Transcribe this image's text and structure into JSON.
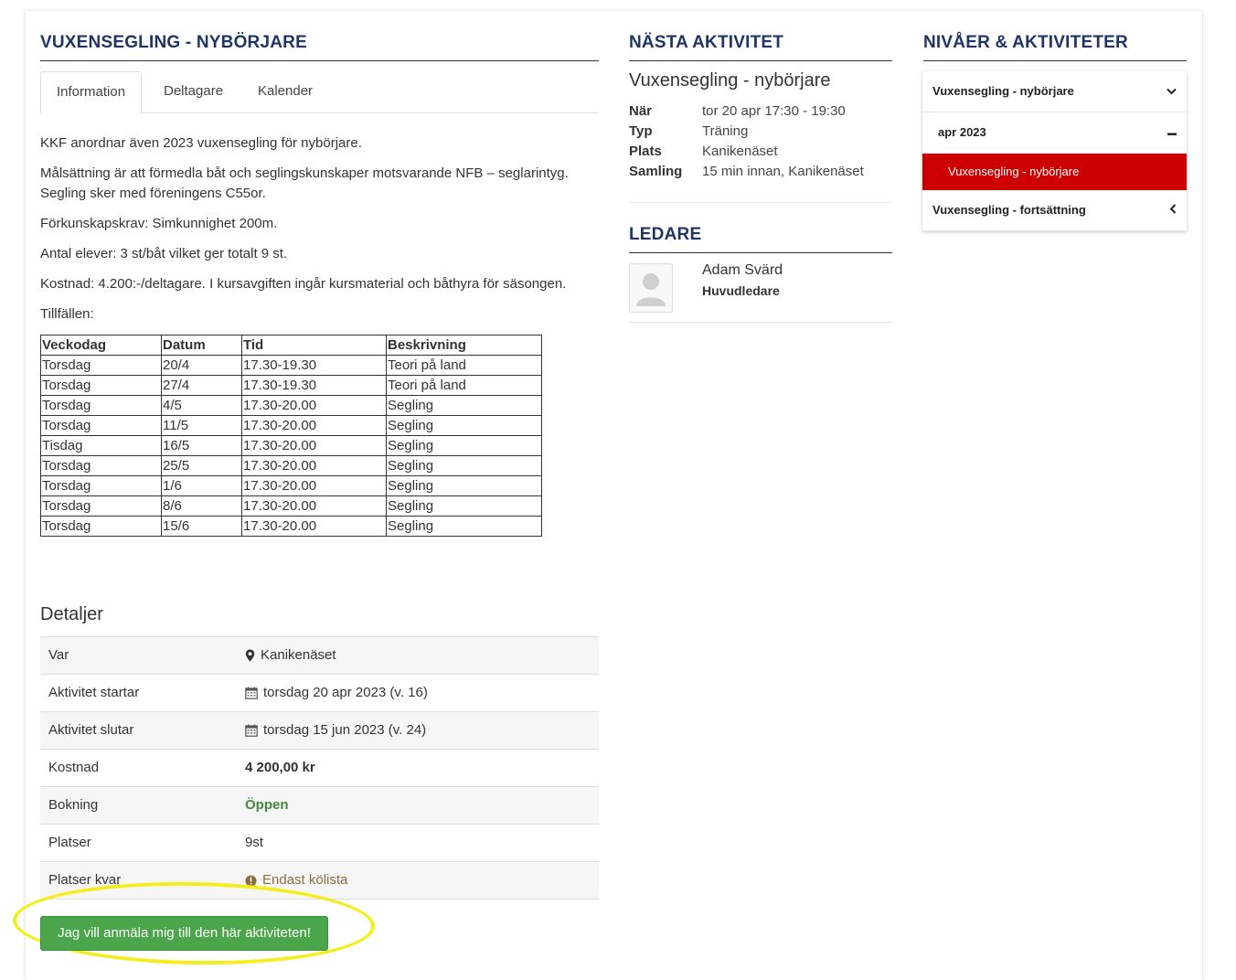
{
  "main": {
    "title": "VUXENSEGLING - NYBÖRJARE",
    "tabs": [
      "Information",
      "Deltagare",
      "Kalender"
    ],
    "paragraphs": [
      "KKF anordnar även 2023 vuxensegling för nybörjare.",
      "Målsättning är att förmedla båt och seglingskunskaper motsvarande NFB – seglarintyg. Segling sker med föreningens C55or.",
      "Förkunskapskrav: Simkunnighet 200m.",
      "Antal elever: 3 st/båt vilket ger totalt 9 st.",
      "Kostnad: 4.200:-/deltagare. I kursavgiften ingår kursmaterial och båthyra för säsongen.",
      "Tillfällen:"
    ],
    "schedule": {
      "headers": [
        "Veckodag",
        "Datum",
        "Tid",
        "Beskrivning"
      ],
      "rows": [
        [
          "Torsdag",
          "20/4",
          "17.30-19.30",
          "Teori på land"
        ],
        [
          "Torsdag",
          "27/4",
          "17.30-19.30",
          "Teori på land"
        ],
        [
          "Torsdag",
          "4/5",
          "17.30-20.00",
          "Segling"
        ],
        [
          "Torsdag",
          "11/5",
          "17.30-20.00",
          "Segling"
        ],
        [
          "Tisdag",
          "16/5",
          "17.30-20.00",
          "Segling"
        ],
        [
          "Torsdag",
          "25/5",
          "17.30-20.00",
          "Segling"
        ],
        [
          "Torsdag",
          "1/6",
          "17.30-20.00",
          "Segling"
        ],
        [
          "Torsdag",
          "8/6",
          "17.30-20.00",
          "Segling"
        ],
        [
          "Torsdag",
          "15/6",
          "17.30-20.00",
          "Segling"
        ]
      ]
    },
    "details": {
      "title": "Detaljer",
      "rows": [
        {
          "label": "Var",
          "value": "Kanikenäset",
          "icon": "map-marker-icon"
        },
        {
          "label": "Aktivitet startar",
          "value": "torsdag 20 apr 2023 (v. 16)",
          "icon": "calendar-icon"
        },
        {
          "label": "Aktivitet slutar",
          "value": "torsdag 15 jun 2023 (v. 24)",
          "icon": "calendar-icon"
        },
        {
          "label": "Kostnad",
          "value": "4 200,00 kr"
        },
        {
          "label": "Bokning",
          "value": "Öppen",
          "color": "#3f8a3f"
        },
        {
          "label": "Platser",
          "value": "9st"
        },
        {
          "label": "Platser kvar",
          "value": "Endast kölista",
          "icon": "exclamation-circle-icon",
          "color": "#8a6d3b"
        }
      ]
    },
    "signup_label": "Jag vill anmäla mig till den här aktiviteten!"
  },
  "next_activity": {
    "title": "NÄSTA AKTIVITET",
    "name": "Vuxensegling - nybörjare",
    "fields": [
      {
        "k": "När",
        "v": "tor 20 apr 17:30 - 19:30"
      },
      {
        "k": "Typ",
        "v": "Träning"
      },
      {
        "k": "Plats",
        "v": "Kanikenäset"
      },
      {
        "k": "Samling",
        "v": "15 min innan, Kanikenäset"
      }
    ]
  },
  "leaders": {
    "title": "LEDARE",
    "name": "Adam Svärd",
    "role": "Huvudledare"
  },
  "levels": {
    "title": "NIVÅER & AKTIVITETER",
    "items": [
      {
        "label": "Vuxensegling - nybörjare",
        "icon": "chevron-down-icon"
      },
      {
        "label": "apr 2023",
        "icon": "minus-icon"
      },
      {
        "label": "Vuxensegling - nybörjare",
        "active": true
      },
      {
        "label": "Vuxensegling - fortsättning",
        "icon": "chevron-left-icon"
      }
    ]
  },
  "colors": {
    "heading": "#1f3566",
    "active": "#cc0000",
    "button": "#4ba64b",
    "highlight": "#f4ee1f"
  }
}
